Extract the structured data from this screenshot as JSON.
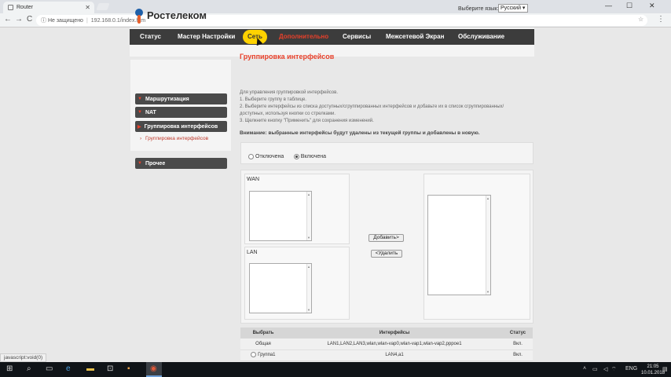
{
  "browser": {
    "tab_title": "Router",
    "tab_close": "✕",
    "minimize": "—",
    "maximize": "☐",
    "close": "✕",
    "back": "←",
    "forward": "→",
    "reload": "C",
    "security_label": "Не защищено",
    "url": "192.168.0.1/index.htm",
    "star": "☆",
    "menu": "⋮",
    "status_text": "javascript:void(0)"
  },
  "header": {
    "brand": "Ростелеком",
    "lang_label": "Выберите язык:",
    "lang_value": "Русский ▾"
  },
  "nav": {
    "items": [
      {
        "label": "Статус"
      },
      {
        "label": "Мастер Настройки"
      },
      {
        "label": "Сеть"
      },
      {
        "label": "Дополнительно"
      },
      {
        "label": "Сервисы"
      },
      {
        "label": "Межсетевой Экран"
      },
      {
        "label": "Обслуживание"
      }
    ]
  },
  "sidebar": {
    "items": [
      {
        "label": "Маршрутизация"
      },
      {
        "label": "NAT"
      },
      {
        "label": "Группировка интерфейсов"
      },
      {
        "label": "Прочее"
      }
    ],
    "sub_item": "Группировка интерфейсов"
  },
  "content": {
    "title": "Группировка интерфейсов",
    "lines": [
      "Для управления группировкой интерфейсов.",
      "1. Выберите группу в таблице.",
      "2. Выберите интерфейсы из списка доступных/сгруппированных интерфейсов и добавьте их в список сгруппированных/",
      "доступных, используя кнопки со стрелками.",
      "3. Щелкните кнопку \"Применить\" для сохранения изменений."
    ],
    "warning": "Внимание: выбранные интерфейсы будут удалены из текущей группы и добавлены в новую.",
    "radio_off": "Отключена",
    "radio_on": "Включена",
    "wan_label": "WAN",
    "lan_label": "LAN",
    "add_button": "Добавить>",
    "remove_button": "<Удалить"
  },
  "table": {
    "headers": [
      "Выбрать",
      "Интерфейсы",
      "Статус"
    ],
    "rows": [
      {
        "select": "Общая",
        "interfaces": "LAN1,LAN2,LAN3,wlan,wlan-vap0,wlan-vap1,wlan-vap2,pppoe1",
        "status": "Вкл."
      },
      {
        "select": "Группа1",
        "interfaces": "LAN4,a1",
        "status": "Вкл."
      }
    ]
  },
  "taskbar": {
    "lang": "ENG",
    "time": "21:05",
    "date": "10.01.2018"
  }
}
